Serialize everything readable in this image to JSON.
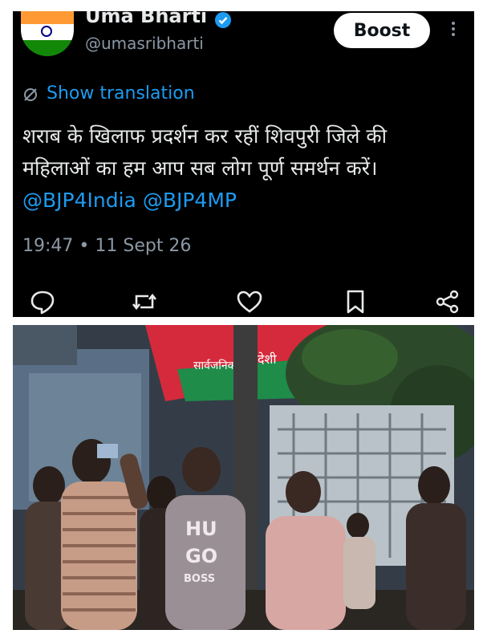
{
  "tweet": {
    "author_name": "Uma Bharti",
    "handle": "@umasribharti",
    "boost_label": "Boost",
    "show_translation": "Show translation",
    "text_line1": "शराब के खिलाफ प्रदर्शन कर रहीं शिवपुरी जिले की",
    "text_line2": "महिलाओं का हम आप सब लोग पूर्ण समर्थन करें।",
    "mention1": "@BJP4India",
    "mention2": "@BJP4MP",
    "timestamp": "19:47 • 11 Sept 26",
    "icons": [
      "reply-icon",
      "retweet-icon",
      "like-icon",
      "bookmark-icon",
      "share-icon"
    ]
  },
  "photo": {
    "sign_text_left": "सार्वजनिक",
    "sign_text_right": "देशी",
    "shirt_text_1": "HU",
    "shirt_text_2": "GO",
    "shirt_text_3": "BOSS"
  },
  "colors": {
    "background": "#000000",
    "text": "#e7e9ea",
    "muted": "#8b98a5",
    "link": "#1d9bf0",
    "verified": "#1d9bf0"
  }
}
